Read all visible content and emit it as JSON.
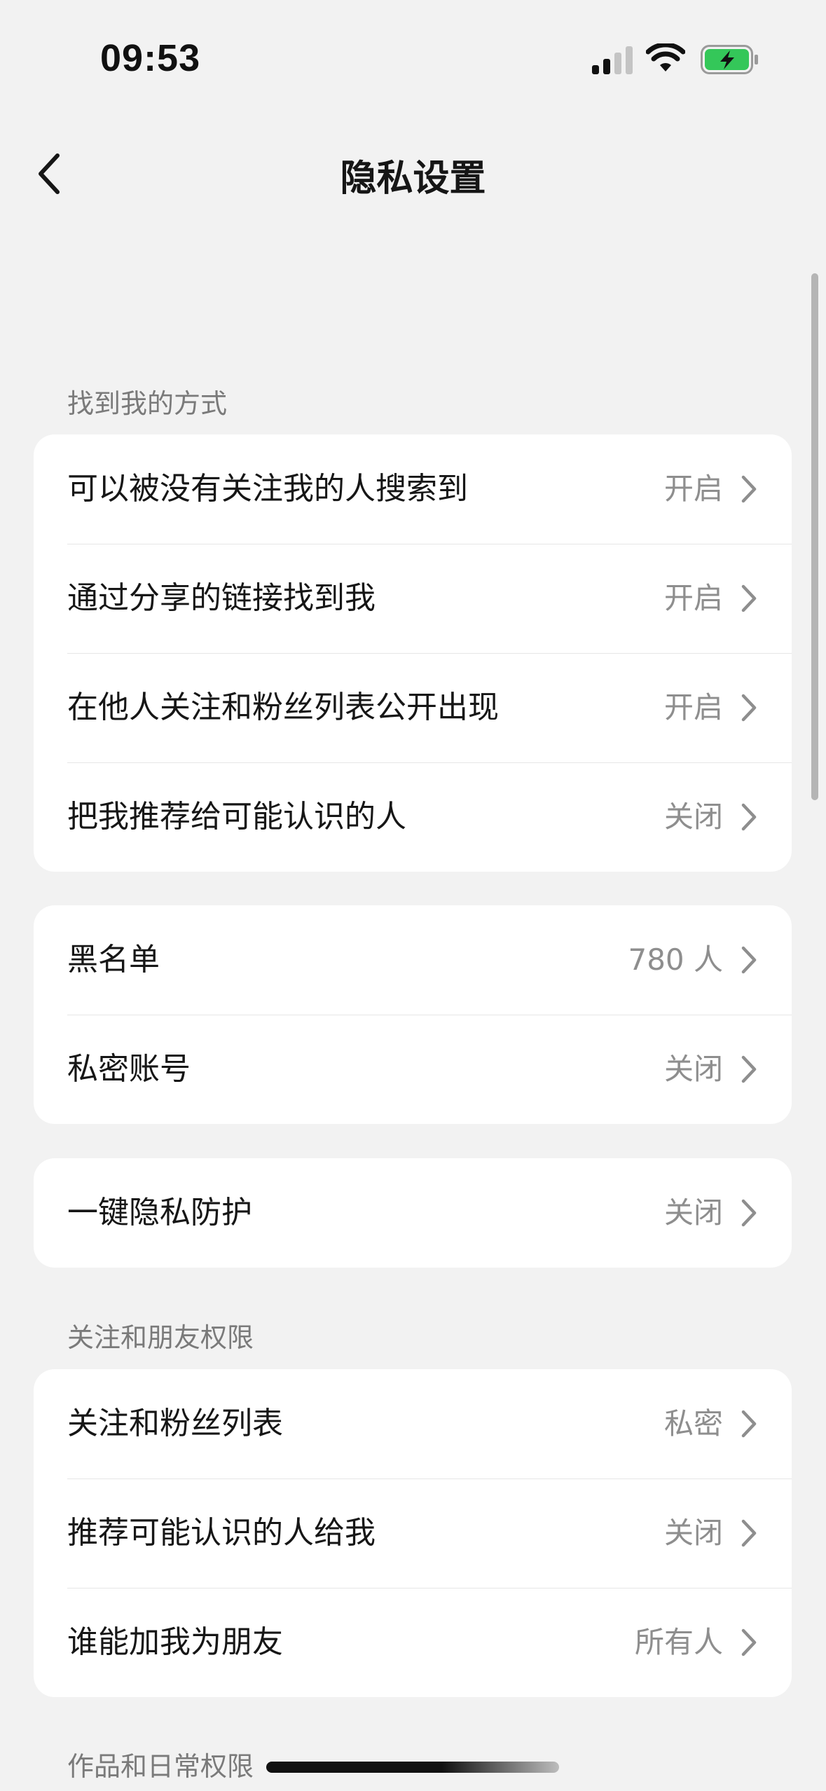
{
  "status_bar": {
    "time": "09:53"
  },
  "nav": {
    "title": "隐私设置"
  },
  "sections": [
    {
      "header": "找到我的方式",
      "rows": [
        {
          "label": "可以被没有关注我的人搜索到",
          "value": "开启"
        },
        {
          "label": "通过分享的链接找到我",
          "value": "开启"
        },
        {
          "label": "在他人关注和粉丝列表公开出现",
          "value": "开启"
        },
        {
          "label": "把我推荐给可能认识的人",
          "value": "关闭"
        }
      ]
    },
    {
      "header": "",
      "rows": [
        {
          "label": "黑名单",
          "value": "780 人"
        },
        {
          "label": "私密账号",
          "value": "关闭"
        }
      ]
    },
    {
      "header": "",
      "rows": [
        {
          "label": "一键隐私防护",
          "value": "关闭"
        }
      ]
    },
    {
      "header": "关注和朋友权限",
      "rows": [
        {
          "label": "关注和粉丝列表",
          "value": "私密"
        },
        {
          "label": "推荐可能认识的人给我",
          "value": "关闭"
        },
        {
          "label": "谁能加我为朋友",
          "value": "所有人"
        }
      ]
    },
    {
      "header": "作品和日常权限",
      "rows": []
    }
  ],
  "icons": {
    "back": "chevron-left-icon",
    "row_arrow": "chevron-right-icon",
    "signal": "cellular-signal-icon",
    "wifi": "wifi-icon",
    "battery": "battery-charging-icon"
  },
  "colors": {
    "background": "#f2f2f2",
    "card": "#ffffff",
    "battery_fill": "#34c759"
  }
}
